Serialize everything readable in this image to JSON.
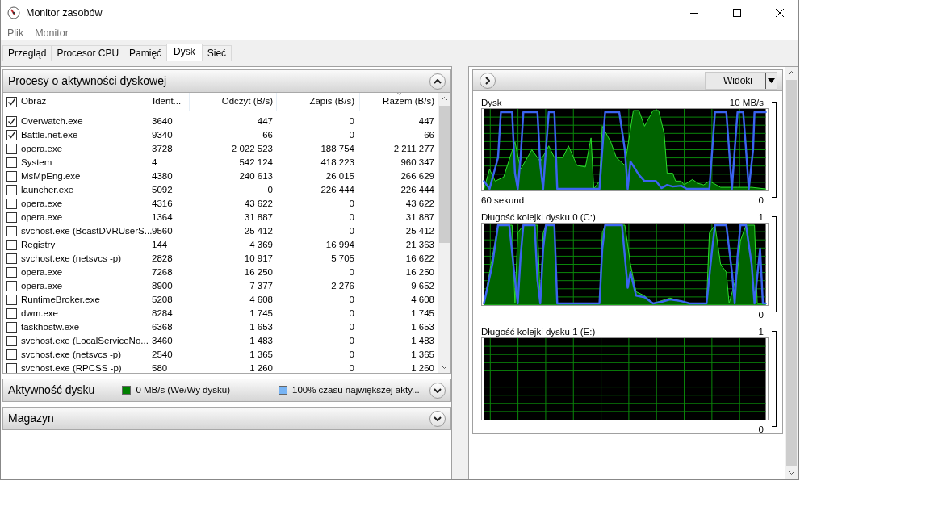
{
  "window": {
    "title": "Monitor zasobów"
  },
  "menu": [
    "Plik",
    "Monitor"
  ],
  "tabs": [
    {
      "label": "Przegląd",
      "selected": false
    },
    {
      "label": "Procesor CPU",
      "selected": false
    },
    {
      "label": "Pamięć",
      "selected": false
    },
    {
      "label": "Dysk",
      "selected": true
    },
    {
      "label": "Sieć",
      "selected": false
    }
  ],
  "processes": {
    "title": "Procesy o aktywności dyskowej",
    "expanded": true,
    "select_all_checked": true,
    "columns": [
      {
        "label": "Obraz",
        "sorted": false
      },
      {
        "label": "Ident...",
        "sorted": false
      },
      {
        "label": "Odczyt (B/s)",
        "sorted": false
      },
      {
        "label": "Zapis (B/s)",
        "sorted": false
      },
      {
        "label": "Razem (B/s)",
        "sorted": true
      }
    ],
    "rows": [
      {
        "checked": true,
        "cells": [
          "Overwatch.exe",
          "3640",
          "447",
          "0",
          "447"
        ]
      },
      {
        "checked": true,
        "cells": [
          "Battle.net.exe",
          "9340",
          "66",
          "0",
          "66"
        ]
      },
      {
        "checked": false,
        "cells": [
          "opera.exe",
          "3728",
          "2 022 523",
          "188 754",
          "2 211 277"
        ]
      },
      {
        "checked": false,
        "cells": [
          "System",
          "4",
          "542 124",
          "418 223",
          "960 347"
        ]
      },
      {
        "checked": false,
        "cells": [
          "MsMpEng.exe",
          "4380",
          "240 613",
          "26 015",
          "266 629"
        ]
      },
      {
        "checked": false,
        "cells": [
          "launcher.exe",
          "5092",
          "0",
          "226 444",
          "226 444"
        ]
      },
      {
        "checked": false,
        "cells": [
          "opera.exe",
          "4316",
          "43 622",
          "0",
          "43 622"
        ]
      },
      {
        "checked": false,
        "cells": [
          "opera.exe",
          "1364",
          "31 887",
          "0",
          "31 887"
        ]
      },
      {
        "checked": false,
        "cells": [
          "svchost.exe (BcastDVRUserS...",
          "9560",
          "25 412",
          "0",
          "25 412"
        ]
      },
      {
        "checked": false,
        "cells": [
          "Registry",
          "144",
          "4 369",
          "16 994",
          "21 363"
        ]
      },
      {
        "checked": false,
        "cells": [
          "svchost.exe (netsvcs -p)",
          "2828",
          "10 917",
          "5 705",
          "16 622"
        ]
      },
      {
        "checked": false,
        "cells": [
          "opera.exe",
          "7268",
          "16 250",
          "0",
          "16 250"
        ]
      },
      {
        "checked": false,
        "cells": [
          "opera.exe",
          "8900",
          "7 377",
          "2 276",
          "9 652"
        ]
      },
      {
        "checked": false,
        "cells": [
          "RuntimeBroker.exe",
          "5208",
          "4 608",
          "0",
          "4 608"
        ]
      },
      {
        "checked": false,
        "cells": [
          "dwm.exe",
          "8284",
          "1 745",
          "0",
          "1 745"
        ]
      },
      {
        "checked": false,
        "cells": [
          "taskhostw.exe",
          "6368",
          "1 653",
          "0",
          "1 653"
        ]
      },
      {
        "checked": false,
        "cells": [
          "svchost.exe (LocalServiceNo...",
          "3460",
          "1 483",
          "0",
          "1 483"
        ]
      },
      {
        "checked": false,
        "cells": [
          "svchost.exe (netsvcs -p)",
          "2540",
          "1 365",
          "0",
          "1 365"
        ]
      },
      {
        "checked": false,
        "cells": [
          "svchost.exe (RPCSS -p)",
          "580",
          "1 260",
          "0",
          "1 260"
        ]
      }
    ]
  },
  "sections": [
    {
      "title": "Aktywność dysku",
      "expanded": false,
      "legend": [
        {
          "label": "0 MB/s (We/Wy dysku)",
          "color": "#008000"
        },
        {
          "label": "100% czasu największej akty...",
          "color": "#78b4f4"
        }
      ]
    },
    {
      "title": "Magazyn",
      "expanded": false
    }
  ],
  "graphs_pane": {
    "views_button": "Widoki",
    "graphs": [
      {
        "kind": "trace",
        "title": "Dysk",
        "max": "10 MB/s",
        "time": "60 sekund",
        "min": "0"
      },
      {
        "kind": "trace",
        "title": "Długość kolejki dysku 0 (C:)",
        "max": "1",
        "min": "0"
      },
      {
        "kind": "idle",
        "title": "Długość kolejki dysku 1 (E:)",
        "max": "1",
        "min": "0"
      }
    ]
  }
}
